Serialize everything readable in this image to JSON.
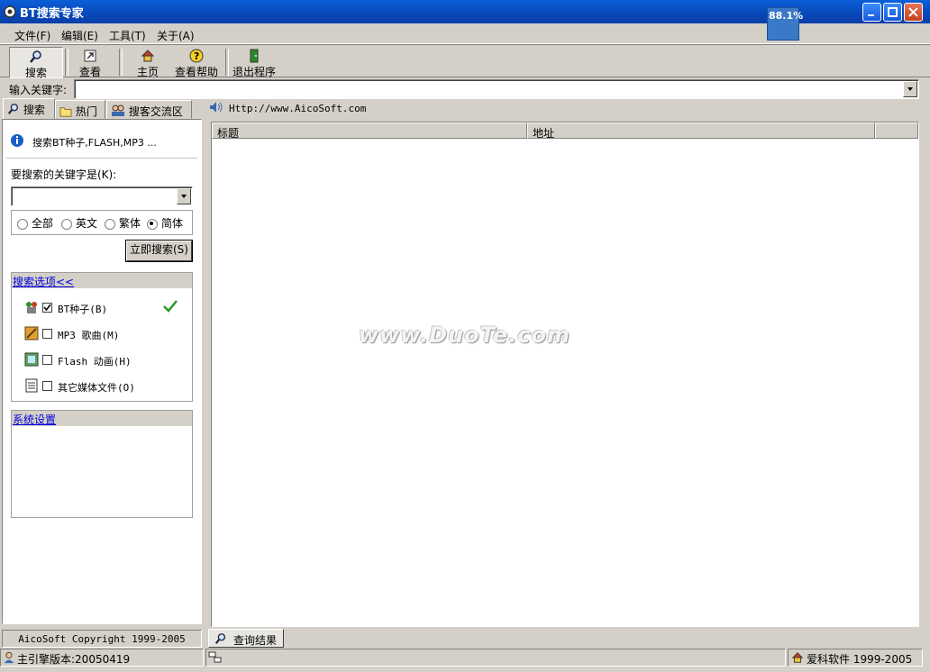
{
  "window": {
    "title": "BT搜索专家",
    "cpu_label": "88.1%"
  },
  "menu": [
    "文件(F)",
    "编辑(E)",
    "工具(T)",
    "关于(A)"
  ],
  "toolbar": {
    "search": "搜索",
    "view": "查看",
    "home": "主页",
    "help": "查看帮助",
    "exit": "退出程序"
  },
  "keyword_bar": {
    "label": "输入关键字:",
    "value": ""
  },
  "left_tabs": [
    "搜索",
    "热门",
    "搜客交流区"
  ],
  "info": {
    "text": "搜索BT种子,FLASH,MP3 ..."
  },
  "search_form": {
    "label": "要搜索的关键字是(K):",
    "value": "",
    "radios": [
      "全部",
      "英文",
      "繁体",
      "简体"
    ],
    "selected_radio": "简体",
    "search_button": "立即搜索(S)"
  },
  "options_group": {
    "header": "搜索选项<<",
    "items": [
      {
        "label": "BT种子(B)",
        "checked": true,
        "icon": "bt-seed-icon"
      },
      {
        "label": "MP3 歌曲(M)",
        "checked": false,
        "icon": "mp3-icon"
      },
      {
        "label": "Flash 动画(H)",
        "checked": false,
        "icon": "flash-icon"
      },
      {
        "label": "其它媒体文件(O)",
        "checked": false,
        "icon": "document-icon"
      }
    ]
  },
  "settings_group": {
    "header": "系统设置"
  },
  "left_footer": "AicoSoft Copyright 1999-2005",
  "url_bar": {
    "text": "Http://www.AicoSoft.com"
  },
  "results": {
    "columns": [
      "标题",
      "地址"
    ]
  },
  "watermark": "www.DuoTe.com",
  "bottom_tab": "查询结果",
  "status": {
    "engine_version": "主引擎版本:20050419",
    "company": "爱科软件 1999-2005"
  }
}
